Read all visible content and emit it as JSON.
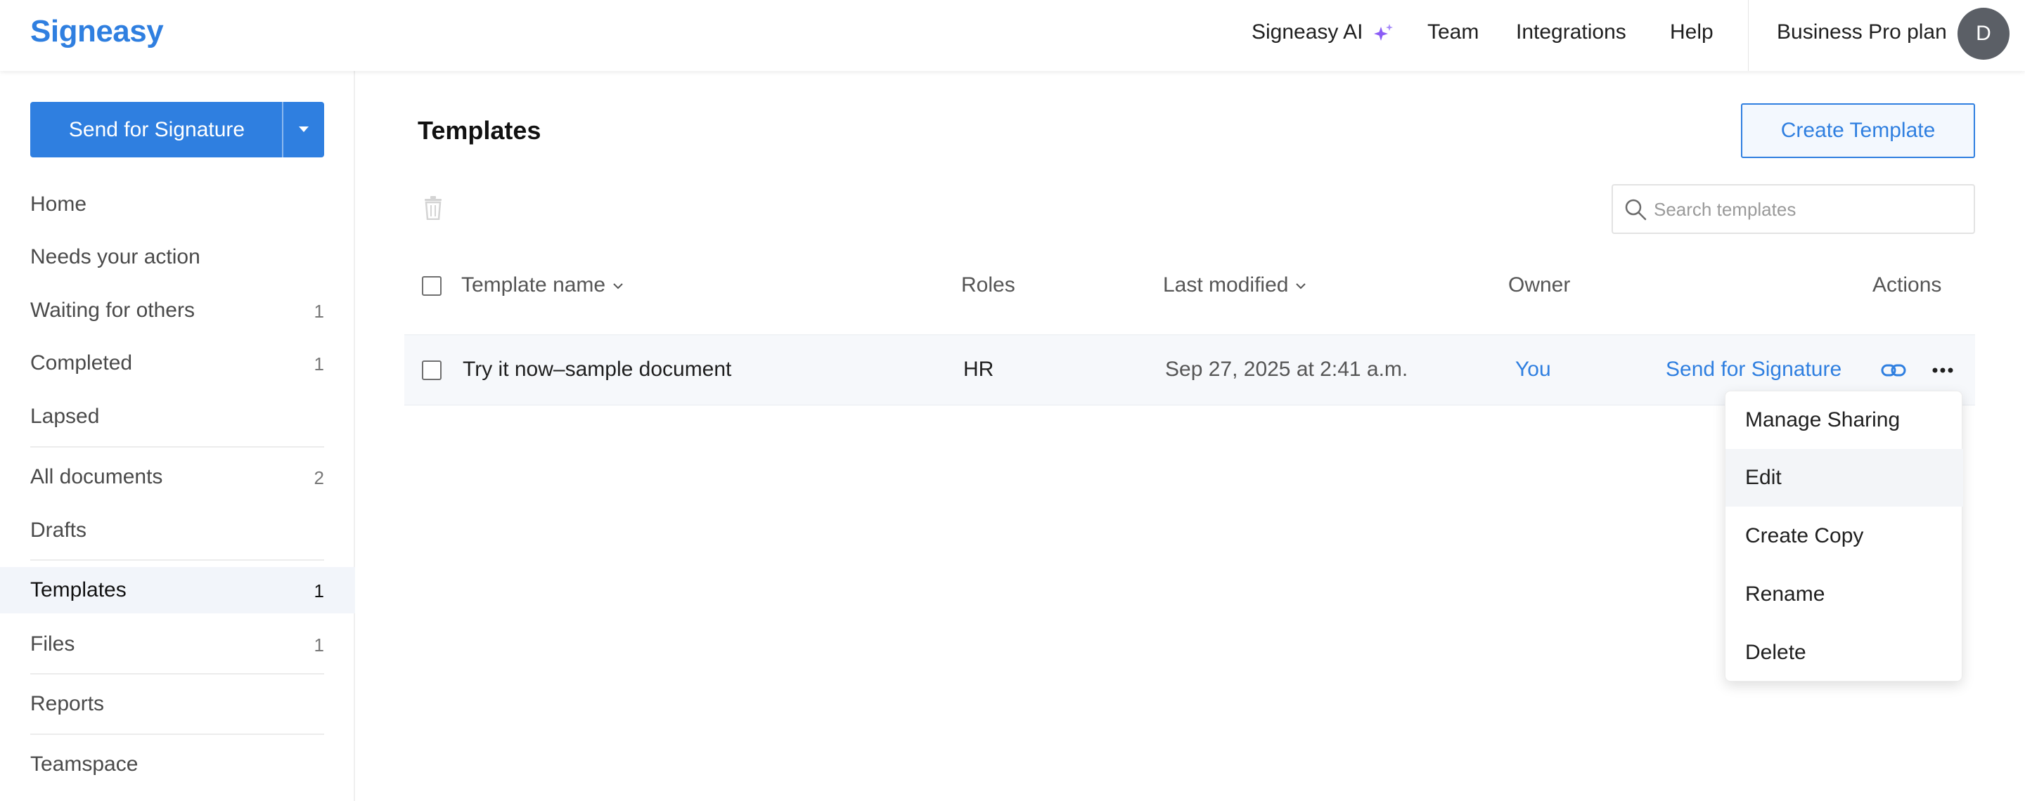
{
  "header": {
    "logo": "Signeasy",
    "nav": {
      "ai": "Signeasy AI",
      "team": "Team",
      "integrations": "Integrations",
      "help": "Help"
    },
    "plan": "Business Pro plan",
    "avatar_initial": "D",
    "ai_accent_color": "#8b5cf6"
  },
  "sidebar": {
    "send_button": "Send for Signature",
    "items": [
      {
        "label": "Home",
        "count": ""
      },
      {
        "label": "Needs your action",
        "count": ""
      },
      {
        "label": "Waiting for others",
        "count": "1"
      },
      {
        "label": "Completed",
        "count": "1"
      },
      {
        "label": "Lapsed",
        "count": ""
      },
      {
        "label": "All documents",
        "count": "2"
      },
      {
        "label": "Drafts",
        "count": ""
      },
      {
        "label": "Templates",
        "count": "1"
      },
      {
        "label": "Files",
        "count": "1"
      },
      {
        "label": "Reports",
        "count": ""
      },
      {
        "label": "Teamspace",
        "count": ""
      }
    ],
    "active_item": "Templates"
  },
  "main": {
    "title": "Templates",
    "create_button": "Create Template",
    "search_placeholder": "Search templates",
    "columns": {
      "name": "Template name",
      "roles": "Roles",
      "modified": "Last modified",
      "owner": "Owner",
      "actions": "Actions"
    },
    "rows": [
      {
        "name": "Try it now–sample document",
        "roles": "HR",
        "modified": "Sep 27, 2025 at 2:41 a.m.",
        "owner": "You",
        "action": "Send for Signature"
      }
    ],
    "menu": {
      "items": [
        "Manage Sharing",
        "Edit",
        "Create Copy",
        "Rename",
        "Delete"
      ],
      "highlighted": "Edit"
    }
  },
  "colors": {
    "brand": "#2f7fe0",
    "active_row": "#f2f5fa"
  }
}
